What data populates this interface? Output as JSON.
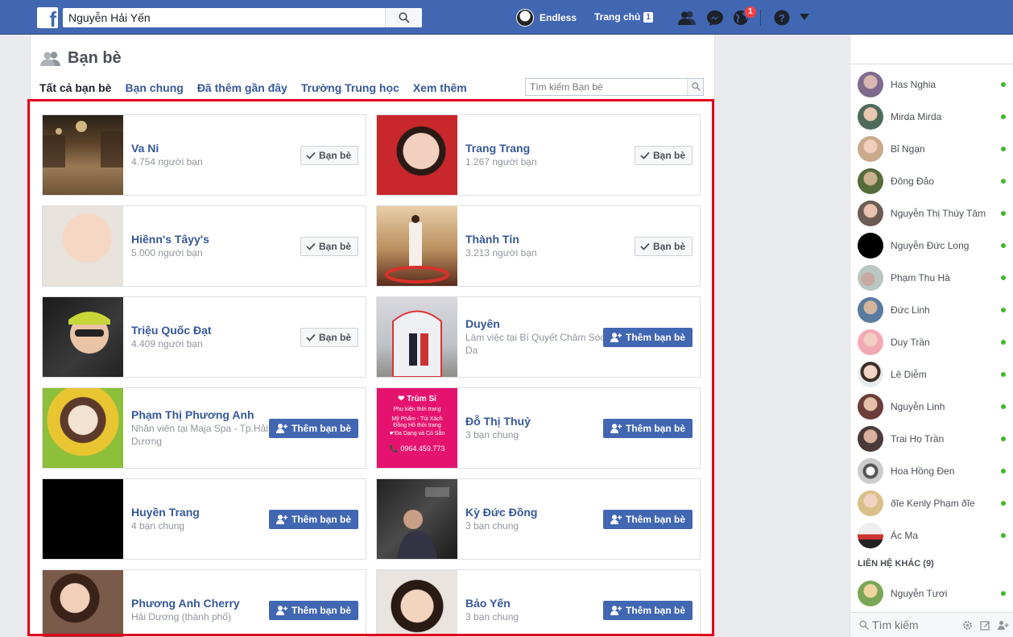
{
  "topbar": {
    "logo": "f",
    "search_value": "Nguyễn Hải Yến",
    "profile_name": "Endless",
    "home_label": "Trang chủ",
    "home_count": "1",
    "notifications_count": "1",
    "colors": {
      "brand": "#4267b2",
      "badge": "#fa3e3e"
    }
  },
  "friends_page": {
    "title": "Bạn bè",
    "tabs": [
      "Tất cả bạn bè",
      "Bạn chung",
      "Đã thêm gần đây",
      "Trường Trung học",
      "Xem thêm"
    ],
    "search_placeholder": "Tìm kiếm Bạn bè",
    "friend_button": "Bạn bè",
    "add_button": "Thêm bạn bè",
    "cards": [
      {
        "name": "Va Ni",
        "sub": "4.754 người bạn",
        "button": "friend"
      },
      {
        "name": "Trang Trang",
        "sub": "1.267 người bạn",
        "button": "friend"
      },
      {
        "name": "Hiềnn's Tâyy's",
        "sub": "5.000 người bạn",
        "button": "friend"
      },
      {
        "name": "Thành Tỉn",
        "sub": "3.213 người bạn",
        "button": "friend"
      },
      {
        "name": "Triệu Quốc Đạt",
        "sub": "4.409 người bạn",
        "button": "friend"
      },
      {
        "name": "Duyên",
        "sub": "Làm việc tại Bí Quyết Chăm Sóc Da",
        "button": "add"
      },
      {
        "name": "Phạm Thị Phương Anh",
        "sub": "Nhân viên tại Maja Spa - Tp.Hải Dương",
        "button": "add"
      },
      {
        "name": "Đỗ Thị Thuỷ",
        "sub": "3 bạn chung",
        "button": "add"
      },
      {
        "name": "Huyền Trang",
        "sub": "4 bạn chung",
        "button": "add"
      },
      {
        "name": "Kỳ Đức Đồng",
        "sub": "3 bạn chung",
        "button": "add"
      },
      {
        "name": "Phương Anh Cherry",
        "sub": "Hải Dương (thành phố)",
        "button": "add"
      },
      {
        "name": "Bảo Yến",
        "sub": "3 bạn chung",
        "button": "add"
      }
    ],
    "promo_image": {
      "lines": [
        "❤ Trùm Sỉ",
        "Phụ kiện thời trang",
        "Mỹ Phẩm - Túi Xách",
        "Đồng Hồ thời trang",
        "☛Đa Dạng và Có Sẵn",
        "📞 0964.459.773"
      ]
    }
  },
  "chat": {
    "contacts": [
      "Has Nghia",
      "Mirda Mirda",
      "Bỉ Ngạn",
      "Đông Đảo",
      "Nguyễn Thị Thùy Tâm",
      "Nguyễn Đức Long",
      "Phạm Thu Hà",
      "Đức Linh",
      "Duy Trần",
      "Lê Diễm",
      "Nguyễn Linh",
      "Trai Họ Trần",
      "Hoa Hồng Đen",
      "ðĩe Kenly Phạm ðĩe",
      "Ác Ma"
    ],
    "other_contacts_header": "LIÊN HỆ KHÁC (9)",
    "other_contacts": [
      "Nguyễn Tươi"
    ],
    "search_placeholder": "Tìm kiếm"
  }
}
